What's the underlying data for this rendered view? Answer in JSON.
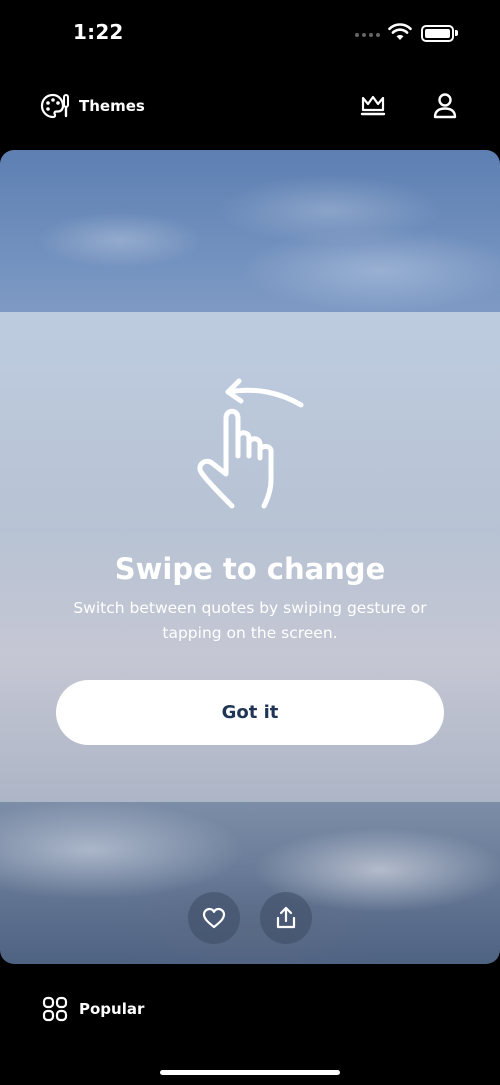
{
  "status_bar": {
    "time": "1:22"
  },
  "top_bar": {
    "themes_label": "Themes"
  },
  "tip": {
    "title": "Swipe to change",
    "text": "Switch between quotes by swiping gesture or tapping on the screen.",
    "button_label": "Got it"
  },
  "bottom_bar": {
    "popular_label": "Popular"
  },
  "icons": {
    "themes": "palette-icon",
    "premium": "crown-icon",
    "profile": "user-icon",
    "gesture": "swipe-hand-icon",
    "like": "heart-icon",
    "share": "share-icon",
    "popular": "grid-icon"
  },
  "colors": {
    "button_text": "#1f3553",
    "background": "#000000"
  }
}
